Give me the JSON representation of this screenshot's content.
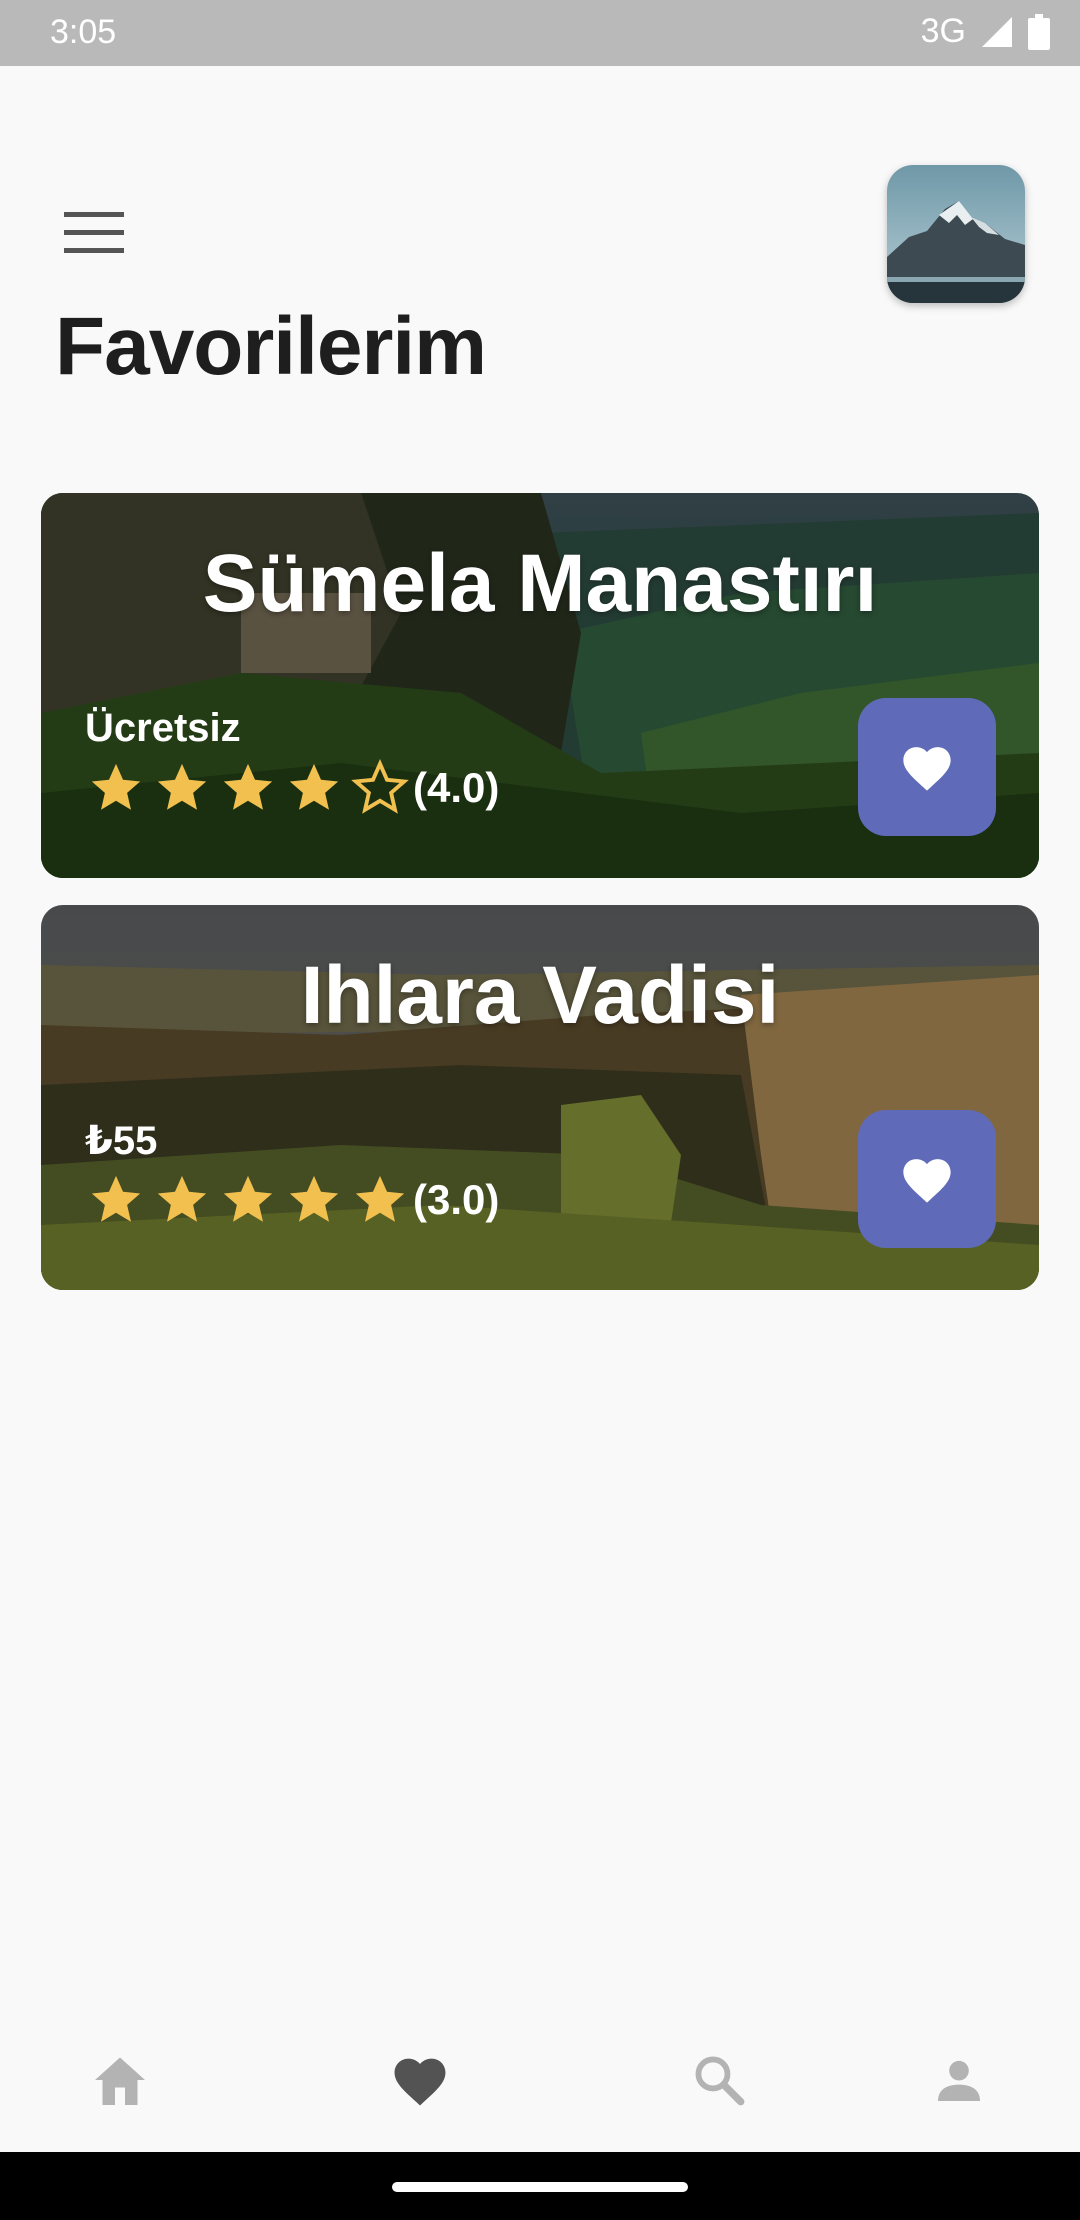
{
  "status_bar": {
    "time": "3:05",
    "network": "3G"
  },
  "header": {
    "menu_icon": "hamburger-menu-icon",
    "avatar_icon": "mountain-photo",
    "title": "Favorilerim"
  },
  "favorites": [
    {
      "title": "Sümela Manastırı",
      "price": "Ücretsiz",
      "stars": [
        "filled",
        "filled",
        "filled",
        "filled",
        "outline"
      ],
      "rating_text": "(4.0)",
      "favorite_icon": "heart-icon"
    },
    {
      "title": "Ihlara Vadisi",
      "price": "₺55",
      "stars": [
        "filled",
        "filled",
        "filled",
        "filled",
        "filled"
      ],
      "rating_text": "(3.0)",
      "favorite_icon": "heart-icon"
    }
  ],
  "bottom_nav": [
    {
      "name": "home",
      "icon": "home-icon",
      "active": false
    },
    {
      "name": "favorites",
      "icon": "heart-icon",
      "active": true
    },
    {
      "name": "search",
      "icon": "search-icon",
      "active": false
    },
    {
      "name": "profile",
      "icon": "person-icon",
      "active": false
    }
  ],
  "colors": {
    "accent": "#5f6bb8",
    "star": "#f1c04f",
    "nav_active": "#535353",
    "nav_inactive": "#b3b3b3",
    "title": "#1e1e1e"
  }
}
